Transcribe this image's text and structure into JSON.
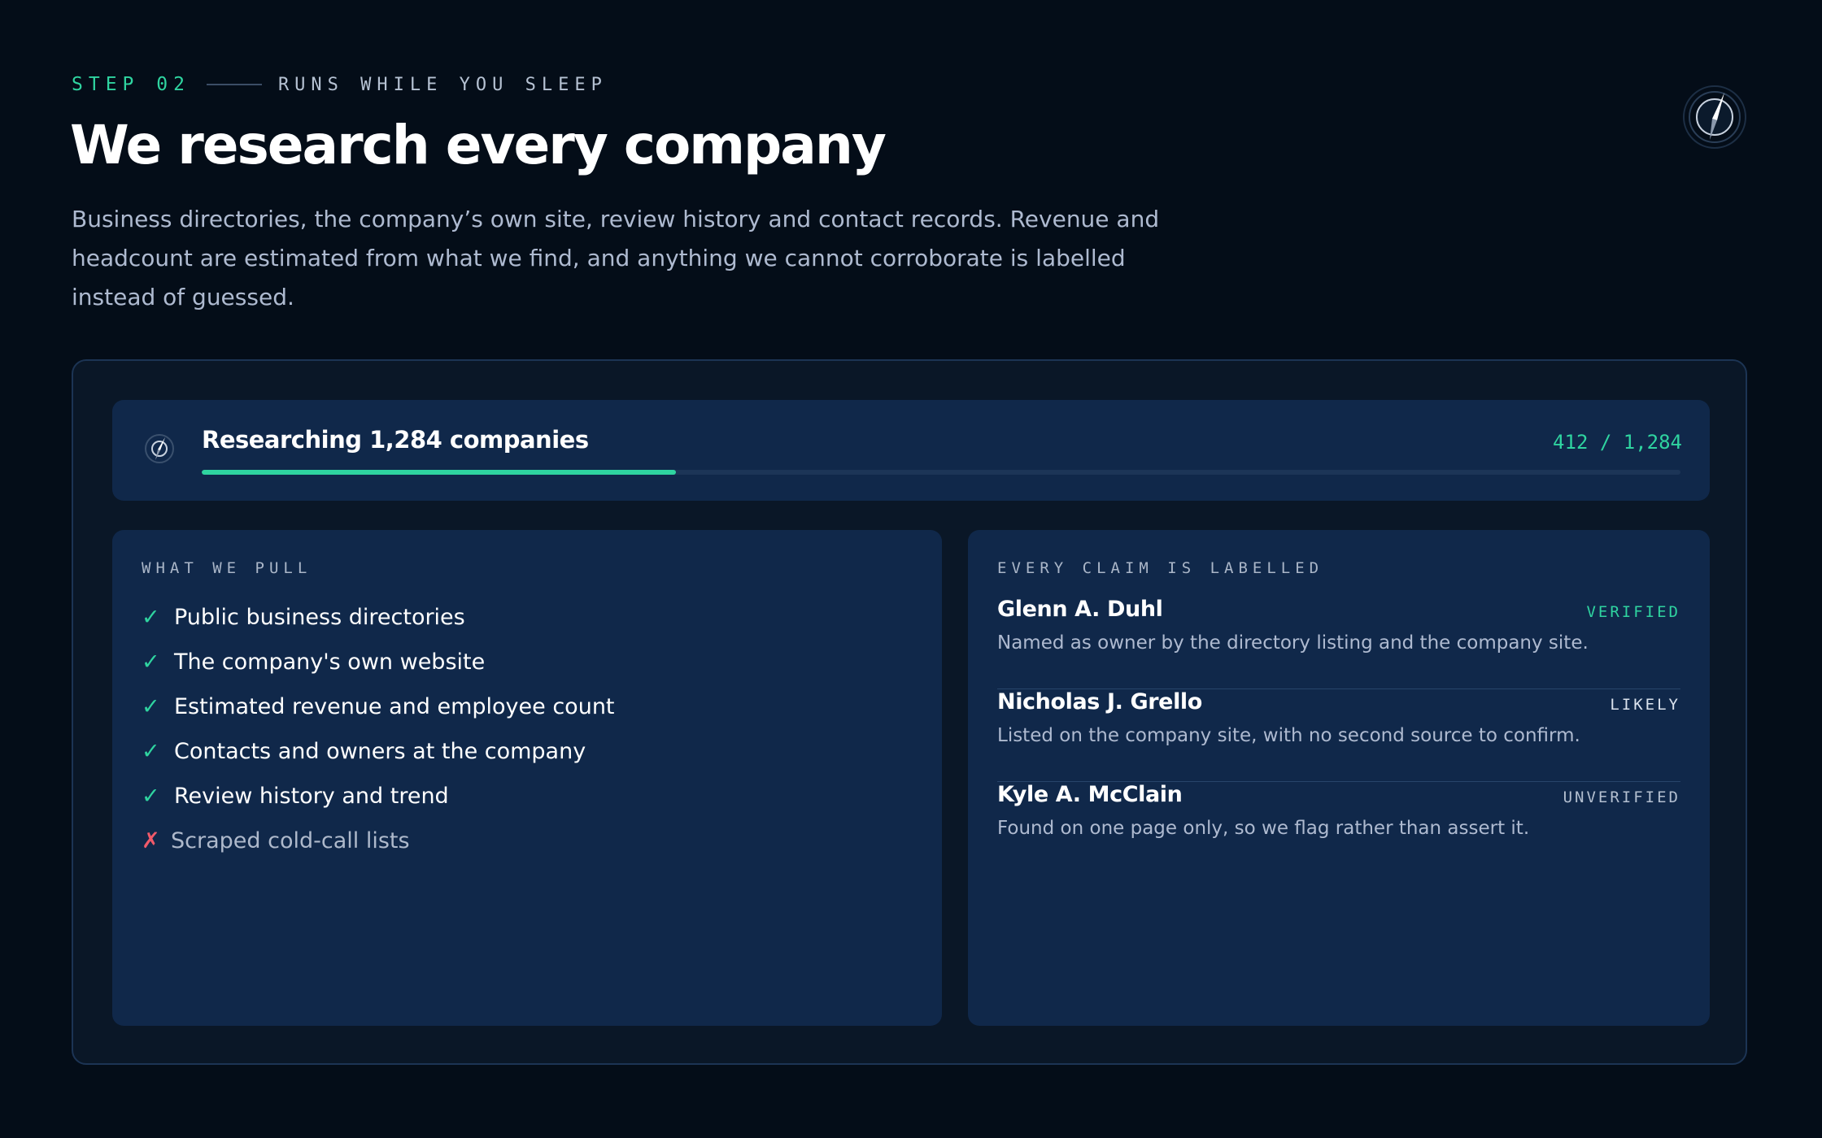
{
  "header": {
    "step": "STEP 02",
    "tag": "RUNS WHILE YOU SLEEP",
    "title": "We research every company",
    "description": "Business directories, the company’s own site, review history and contact records. Revenue and headcount are estimated from what we find, and anything we cannot corroborate is labelled instead of guessed."
  },
  "brand": {
    "icon": "compass-icon"
  },
  "progress": {
    "icon": "compass-icon",
    "title": "Researching 1,284 companies",
    "count_label": "412 / 1,284",
    "done": 412,
    "total": 1284
  },
  "pull": {
    "label": "WHAT WE PULL",
    "items": [
      {
        "mark": "✓",
        "icon": "check-icon",
        "text": "Public business directories"
      },
      {
        "mark": "✓",
        "icon": "check-icon",
        "text": "The company's own website"
      },
      {
        "mark": "✓",
        "icon": "check-icon",
        "text": "Estimated revenue and employee count"
      },
      {
        "mark": "✓",
        "icon": "check-icon",
        "text": "Contacts and owners at the company"
      },
      {
        "mark": "✓",
        "icon": "check-icon",
        "text": "Review history and trend"
      },
      {
        "mark": "✗",
        "icon": "cross-icon",
        "text": "Scraped cold-call lists"
      }
    ]
  },
  "claims": {
    "label": "EVERY CLAIM IS LABELLED",
    "items": [
      {
        "name": "Glenn A. Duhl",
        "status": "VERIFIED",
        "status_color": "#2fd4a0",
        "note": "Named as owner by the directory listing and the company site."
      },
      {
        "name": "Nicholas J. Grello",
        "status": "LIKELY",
        "status_color": "#dbe3ee",
        "note": "Listed on the company site, with no second source to confirm."
      },
      {
        "name": "Kyle A. McClain",
        "status": "UNVERIFIED",
        "status_color": "#b3bfd0",
        "note": "Found on one page only, so we flag rather than assert it."
      }
    ]
  },
  "colors": {
    "background": "#040d18",
    "card": "#10284a",
    "accent": "#2fd4a0",
    "negative": "#f05a6a"
  }
}
